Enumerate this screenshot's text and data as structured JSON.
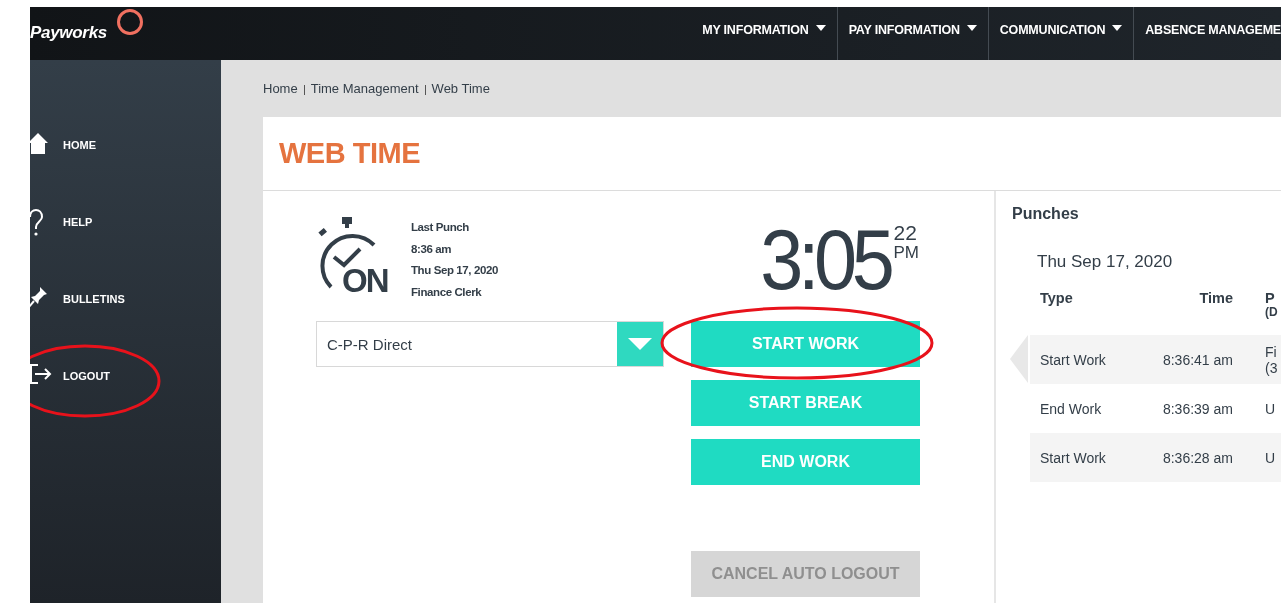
{
  "header": {
    "logo": "Payworks",
    "nav": [
      {
        "label": "MY INFORMATION",
        "caret": true
      },
      {
        "label": "PAY INFORMATION",
        "caret": true
      },
      {
        "label": "COMMUNICATION",
        "caret": true
      },
      {
        "label": "ABSENCE MANAGEME",
        "caret": false
      }
    ]
  },
  "sidebar": {
    "items": [
      {
        "kind": "home",
        "label": "HOME",
        "circled": false
      },
      {
        "kind": "help",
        "label": "HELP",
        "circled": false
      },
      {
        "kind": "pin",
        "label": "BULLETINS",
        "circled": false
      },
      {
        "kind": "logout",
        "label": "LOGOUT",
        "circled": true
      }
    ]
  },
  "breadcrumb": [
    "Home",
    "Time Management",
    "Web Time"
  ],
  "page_title": "WEB TIME",
  "last_punch": {
    "status": "ON",
    "lines": [
      "Last Punch",
      "8:36 am",
      "Thu Sep 17, 2020",
      "Finance Clerk"
    ]
  },
  "clock": {
    "time": "3:05",
    "seconds": "22",
    "period": "PM"
  },
  "position_select": {
    "value": "C-P-R Direct"
  },
  "actions": [
    {
      "label": "START WORK",
      "disabled": false,
      "circled": true
    },
    {
      "label": "START BREAK",
      "disabled": false,
      "circled": false
    },
    {
      "label": "END WORK",
      "disabled": false,
      "circled": false
    }
  ],
  "cancel_button": {
    "label": "CANCEL AUTO LOGOUT",
    "disabled": true
  },
  "punches": {
    "title": "Punches",
    "date": "Thu Sep 17, 2020",
    "columns": [
      "Type",
      "Time",
      [
        "P",
        "(D"
      ]
    ],
    "rows": [
      {
        "type": "Start Work",
        "time": "8:36:41 am",
        "column_3": [
          "Fi",
          "(3"
        ],
        "selected": true
      },
      {
        "type": "End Work",
        "time": "8:36:39 am",
        "column_3": [
          "U"
        ],
        "selected": false
      },
      {
        "type": "Start Work",
        "time": "8:36:28 am",
        "column_3": [
          "U"
        ],
        "selected": false
      }
    ]
  }
}
